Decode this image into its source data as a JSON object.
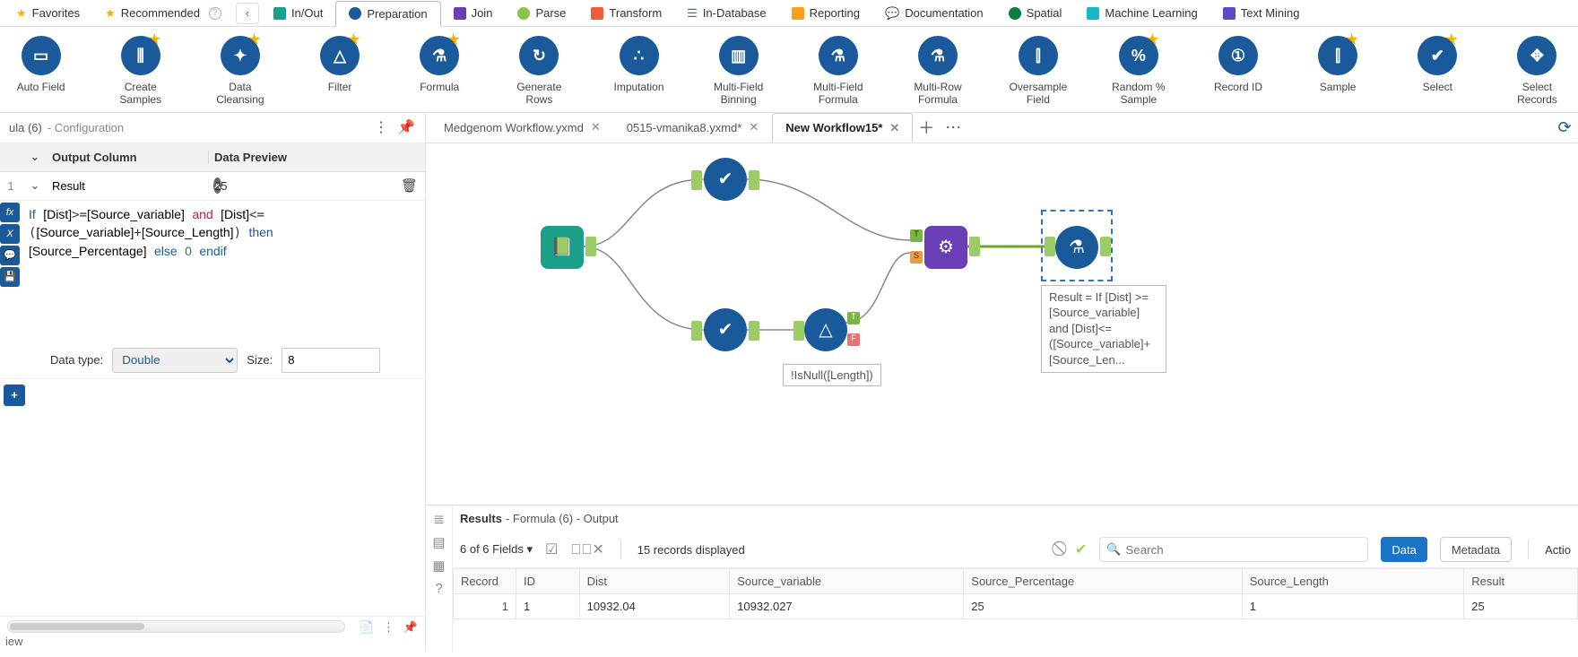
{
  "categories": [
    {
      "label": "Favorites",
      "color": "#f3b300",
      "shape": "star"
    },
    {
      "label": "Recommended",
      "color": "#f3b300",
      "shape": "star"
    },
    {
      "label": "In/Out",
      "color": "#1aa089",
      "shape": "sq"
    },
    {
      "label": "Preparation",
      "color": "#1a5a9a",
      "shape": "dot",
      "active": true
    },
    {
      "label": "Join",
      "color": "#6a3fb5",
      "shape": "sq"
    },
    {
      "label": "Parse",
      "color": "#8bc34a",
      "shape": "dot"
    },
    {
      "label": "Transform",
      "color": "#ef5b3b",
      "shape": "sq"
    },
    {
      "label": "In-Database",
      "color": "#5b6b7a",
      "shape": "dot"
    },
    {
      "label": "Reporting",
      "color": "#f59f1d",
      "shape": "sq"
    },
    {
      "label": "Documentation",
      "color": "#7a8a99",
      "shape": "dot"
    },
    {
      "label": "Spatial",
      "color": "#0a7d3c",
      "shape": "dot"
    },
    {
      "label": "Machine Learning",
      "color": "#17b8c9",
      "shape": "sq"
    },
    {
      "label": "Text Mining",
      "color": "#5c4bc7",
      "shape": "sq"
    }
  ],
  "tools": [
    {
      "label": "Auto Field",
      "glyph": "▭"
    },
    {
      "label": "Create Samples",
      "glyph": "⫼",
      "star": true
    },
    {
      "label": "Data Cleansing",
      "glyph": "✦",
      "star": true
    },
    {
      "label": "Filter",
      "glyph": "△",
      "star": true
    },
    {
      "label": "Formula",
      "glyph": "⚗",
      "star": true
    },
    {
      "label": "Generate Rows",
      "glyph": "↻"
    },
    {
      "label": "Imputation",
      "glyph": "∴"
    },
    {
      "label": "Multi-Field Binning",
      "glyph": "▥"
    },
    {
      "label": "Multi-Field Formula",
      "glyph": "⚗"
    },
    {
      "label": "Multi-Row Formula",
      "glyph": "⚗"
    },
    {
      "label": "Oversample Field",
      "glyph": "⫿"
    },
    {
      "label": "Random % Sample",
      "glyph": "%",
      "star": true
    },
    {
      "label": "Record ID",
      "glyph": "①"
    },
    {
      "label": "Sample",
      "glyph": "⫿",
      "star": true
    },
    {
      "label": "Select",
      "glyph": "✔",
      "star": true
    },
    {
      "label": "Select Records",
      "glyph": "✥"
    }
  ],
  "config": {
    "title_prefix": "ula (6)",
    "title_suffix": " - Configuration",
    "hdr_output": "Output Column",
    "hdr_preview": "Data Preview",
    "row_output": "Result",
    "row_preview": "25",
    "formula_raw": "If [Dist]>=[Source_variable] and [Dist]<=([Source_variable]+[Source_Length]) then [Source_Percentage] else 0 endif",
    "type_label": "Data type:",
    "type_value": "Double",
    "size_label": "Size:",
    "size_value": "8",
    "footer_label": "iew"
  },
  "doc_tabs": [
    {
      "label": "Medgenom Workflow.yxmd"
    },
    {
      "label": "0515-vmanika8.yxmd*"
    },
    {
      "label": "New Workflow15*",
      "active": true
    }
  ],
  "canvas": {
    "filter_anno": "!IsNull([Length])",
    "formula_anno": "Result = If [Dist] >= [Source_variable] and [Dist]<= ([Source_variable]+[Source_Len..."
  },
  "results": {
    "title_strong": "Results",
    "title_rest": " - Formula (6) - Output",
    "fields": "6 of 6 Fields",
    "records": "15 records displayed",
    "search_placeholder": "Search",
    "btn_data": "Data",
    "btn_meta": "Metadata",
    "btn_action": "Actio",
    "columns": [
      "Record",
      "ID",
      "Dist",
      "Source_variable",
      "Source_Percentage",
      "Source_Length",
      "Result"
    ],
    "rows": [
      {
        "rn": "1",
        "cells": [
          "1",
          "10932.04",
          "10932.027",
          "25",
          "1",
          "25"
        ]
      }
    ]
  }
}
